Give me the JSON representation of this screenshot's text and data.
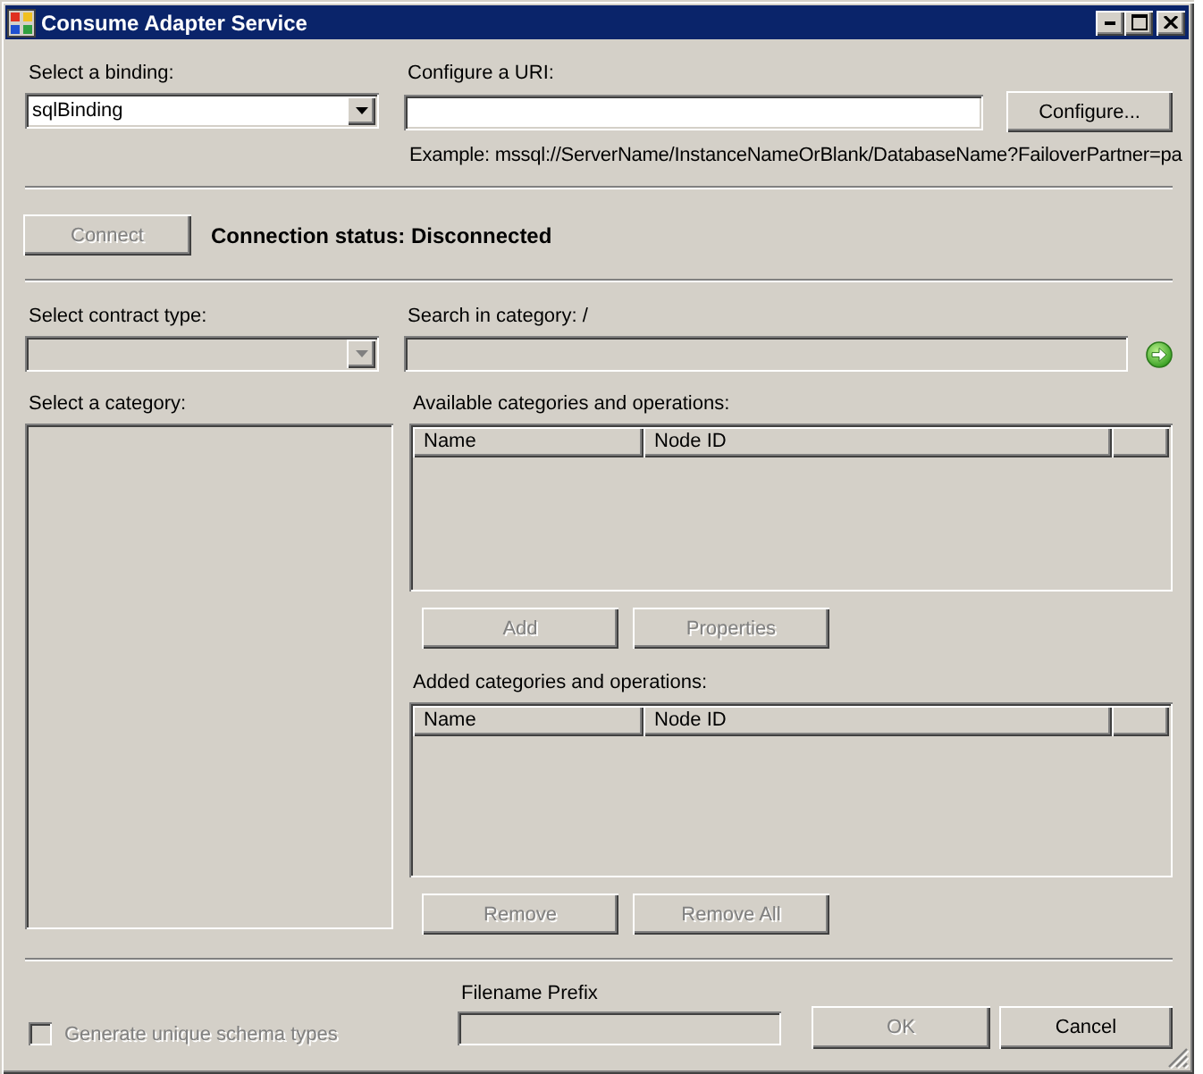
{
  "window": {
    "title": "Consume Adapter Service"
  },
  "binding": {
    "label": "Select a binding:",
    "value": "sqlBinding",
    "disabled": false
  },
  "uri": {
    "label": "Configure a URI:",
    "disabled": false,
    "configure_button": {
      "label": "Configure...",
      "disabled": false
    },
    "example": "Example: mssql://ServerName/InstanceNameOrBlank/DatabaseName?FailoverPartner=pa"
  },
  "connection": {
    "connect_button": {
      "label": "Connect",
      "disabled": true
    },
    "status": "Connection status: Disconnected"
  },
  "contract_type": {
    "label": "Select contract type:",
    "disabled": true
  },
  "search": {
    "label": "Search in category: /",
    "disabled": true
  },
  "category": {
    "label": "Select a category:",
    "disabled": true
  },
  "available": {
    "label": "Available categories and operations:",
    "disabled": true,
    "columns": [
      "Name",
      "Node ID"
    ],
    "buttons": [
      {
        "label": "Add",
        "disabled": true
      },
      {
        "label": "Properties",
        "disabled": true
      }
    ]
  },
  "added": {
    "label": "Added categories and operations:",
    "disabled": true,
    "columns": [
      "Name",
      "Node ID"
    ],
    "buttons": [
      {
        "label": "Remove",
        "disabled": true
      },
      {
        "label": "Remove All",
        "disabled": true
      }
    ]
  },
  "generate_unique": {
    "label": "Generate unique schema types",
    "checked": false,
    "disabled": true
  },
  "filename_prefix": {
    "label": "Filename Prefix",
    "disabled": true
  },
  "buttons": [
    {
      "label": "OK",
      "disabled": true
    },
    {
      "label": "Cancel",
      "disabled": false
    }
  ]
}
